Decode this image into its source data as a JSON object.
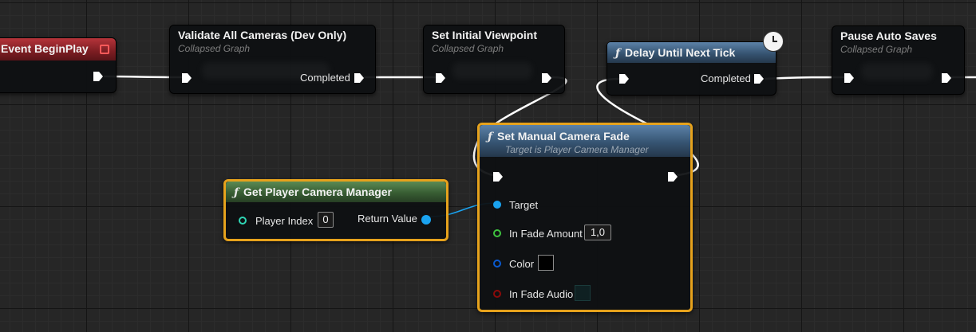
{
  "nodes": {
    "event_begin_play": {
      "title": "Event BeginPlay",
      "color": "#8a2227"
    },
    "validate_cameras": {
      "title": "Validate All Cameras (Dev Only)",
      "subtitle": "Collapsed Graph",
      "output": "Completed"
    },
    "set_initial_viewpoint": {
      "title": "Set Initial Viewpoint",
      "subtitle": "Collapsed Graph"
    },
    "delay_next_tick": {
      "title": "Delay Until Next Tick",
      "output": "Completed",
      "icon": "function-icon",
      "latent_icon": "clock-icon"
    },
    "pause_auto_saves": {
      "title": "Pause Auto Saves",
      "subtitle": "Collapsed Graph"
    },
    "set_manual_camera_fade": {
      "title": "Set Manual Camera Fade",
      "subtitle": "Target is Player Camera Manager",
      "icon": "function-icon",
      "pins": {
        "target": "Target",
        "in_fade_amount": "In Fade Amount",
        "in_fade_amount_value": "1,0",
        "color": "Color",
        "in_fade_audio": "In Fade Audio"
      }
    },
    "get_player_camera_manager": {
      "title": "Get Player Camera Manager",
      "icon": "function-icon",
      "pins": {
        "player_index": "Player Index",
        "player_index_value": "0",
        "return_value": "Return Value"
      }
    }
  },
  "colors": {
    "selection": "#e6a21c",
    "object_pin": "#1aa3f0",
    "int_pin": "#2fd6b5",
    "float_pin": "#3fc43f",
    "struct_pin": "#0a5ad0",
    "bool_pin": "#8c0a0a",
    "exec_wire": "#ffffff"
  }
}
